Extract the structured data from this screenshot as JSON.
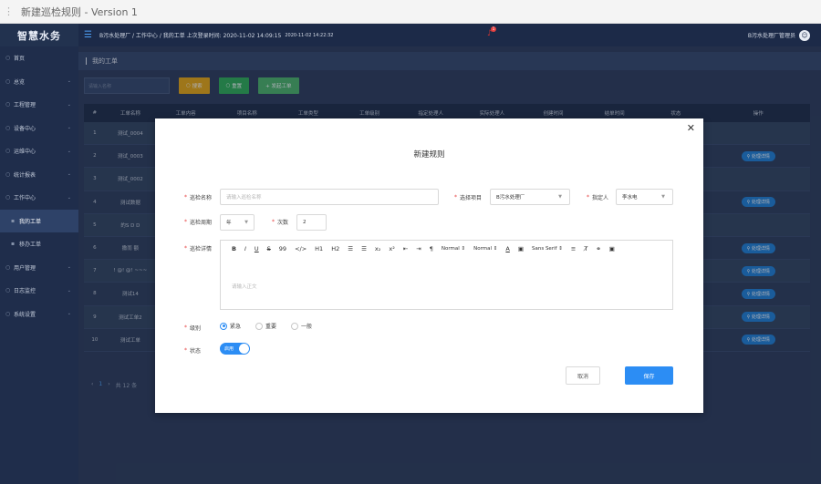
{
  "window": {
    "title": "新建巡检规则 - Version 1"
  },
  "app": {
    "logo": "智慧水务"
  },
  "sidebar": {
    "items": [
      {
        "label": "首页",
        "arrow": false,
        "sub": false,
        "active": false
      },
      {
        "label": "总览",
        "arrow": true,
        "sub": false,
        "active": false
      },
      {
        "label": "工程管理",
        "arrow": true,
        "sub": false,
        "active": false
      },
      {
        "label": "设备中心",
        "arrow": true,
        "sub": false,
        "active": false
      },
      {
        "label": "运维中心",
        "arrow": true,
        "sub": false,
        "active": false
      },
      {
        "label": "统计报表",
        "arrow": true,
        "sub": false,
        "active": false
      },
      {
        "label": "工作中心",
        "arrow": true,
        "sub": false,
        "active": false
      },
      {
        "label": "我的工单",
        "arrow": false,
        "sub": true,
        "active": true
      },
      {
        "label": "移办工单",
        "arrow": false,
        "sub": true,
        "active": false
      },
      {
        "label": "用户管理",
        "arrow": true,
        "sub": false,
        "active": false
      },
      {
        "label": "日志监控",
        "arrow": true,
        "sub": false,
        "active": false
      },
      {
        "label": "系统设置",
        "arrow": true,
        "sub": false,
        "active": false
      }
    ]
  },
  "header": {
    "breadcrumb": "B污水处理厂 / 工作中心 / 我的工单 上次登录时间: 2020-11-02 14:09:15",
    "breadcrumb_time2": "2020-11-02 14:22:32",
    "notification_count": "1",
    "user": "B污水处理厂管理员"
  },
  "page": {
    "title": "我的工单"
  },
  "toolbar": {
    "search_placeholder": "请输入名称",
    "search_label": "搜索",
    "reset_label": "重置",
    "new_label": "+ 发起工单"
  },
  "table": {
    "headers": [
      "#",
      "工单名称",
      "工单内容",
      "项目名称",
      "工单类型",
      "工单级别",
      "指定处理人",
      "实际处理人",
      "创建时间",
      "结单时间",
      "状态",
      "操作"
    ],
    "rows": [
      {
        "no": "1",
        "name": "测试_0004",
        "action": ""
      },
      {
        "no": "2",
        "name": "测试_0003",
        "action": "处理详情"
      },
      {
        "no": "3",
        "name": "测试_0002",
        "action": ""
      },
      {
        "no": "4",
        "name": "测试数据",
        "action": "处理详情"
      },
      {
        "no": "5",
        "name": "的S D D",
        "action": ""
      },
      {
        "no": "6",
        "name": "撒而 额",
        "action": "处理详情"
      },
      {
        "no": "7",
        "name": "! @! @! ~~~",
        "action": "处理详情"
      },
      {
        "no": "8",
        "name": "测试14",
        "action": "处理详情"
      },
      {
        "no": "9",
        "name": "测试工单2",
        "action": "处理详情"
      },
      {
        "no": "10",
        "name": "测试工单",
        "action": "处理详情"
      }
    ]
  },
  "pager": {
    "page": "1",
    "total": "共 12 条"
  },
  "modal": {
    "title": "新建规则",
    "name_label": "巡检名称",
    "name_placeholder": "请输入巡检名称",
    "project_label": "选择项目",
    "project_value": "B污水处理厂",
    "assignee_label": "指定人",
    "assignee_value": "李水电",
    "period_label": "巡检周期",
    "period_value": "年",
    "count_label": "次数",
    "count_value": "2",
    "detail_label": "巡检详情",
    "editor_placeholder": "请输入正文",
    "toolbar": {
      "h1": "H1",
      "h2": "H2",
      "normal1": "Normal",
      "normal2": "Normal",
      "font": "Sans Serif"
    },
    "level_label": "级别",
    "levels": [
      {
        "label": "紧急",
        "checked": true
      },
      {
        "label": "重要",
        "checked": false
      },
      {
        "label": "一般",
        "checked": false
      }
    ],
    "status_label": "状态",
    "status_value": "启用",
    "cancel_label": "取消",
    "save_label": "保存"
  }
}
